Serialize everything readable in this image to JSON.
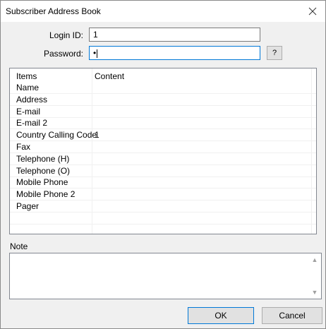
{
  "window": {
    "title": "Subscriber Address Book",
    "close_icon": "close-icon"
  },
  "login": {
    "login_id_label": "Login ID:",
    "login_id_value": "1",
    "password_label": "Password:",
    "password_value": "•",
    "help_label": "?"
  },
  "grid": {
    "columns": [
      "Items",
      "Content"
    ],
    "rows": [
      {
        "item": "Name",
        "content": ""
      },
      {
        "item": "Address",
        "content": ""
      },
      {
        "item": "E-mail",
        "content": ""
      },
      {
        "item": "E-mail 2",
        "content": ""
      },
      {
        "item": "Country Calling Code",
        "content": "1"
      },
      {
        "item": "Fax",
        "content": ""
      },
      {
        "item": "Telephone (H)",
        "content": ""
      },
      {
        "item": "Telephone (O)",
        "content": ""
      },
      {
        "item": "Mobile Phone",
        "content": ""
      },
      {
        "item": "Mobile Phone 2",
        "content": ""
      },
      {
        "item": "Pager",
        "content": ""
      }
    ]
  },
  "note": {
    "label": "Note",
    "value": "",
    "scroll_up_icon": "chevron-up-icon",
    "scroll_down_icon": "chevron-down-icon"
  },
  "buttons": {
    "ok": "OK",
    "cancel": "Cancel"
  },
  "colors": {
    "focus_accent": "#0078d7",
    "dialog_bg": "#f0f0f0"
  }
}
